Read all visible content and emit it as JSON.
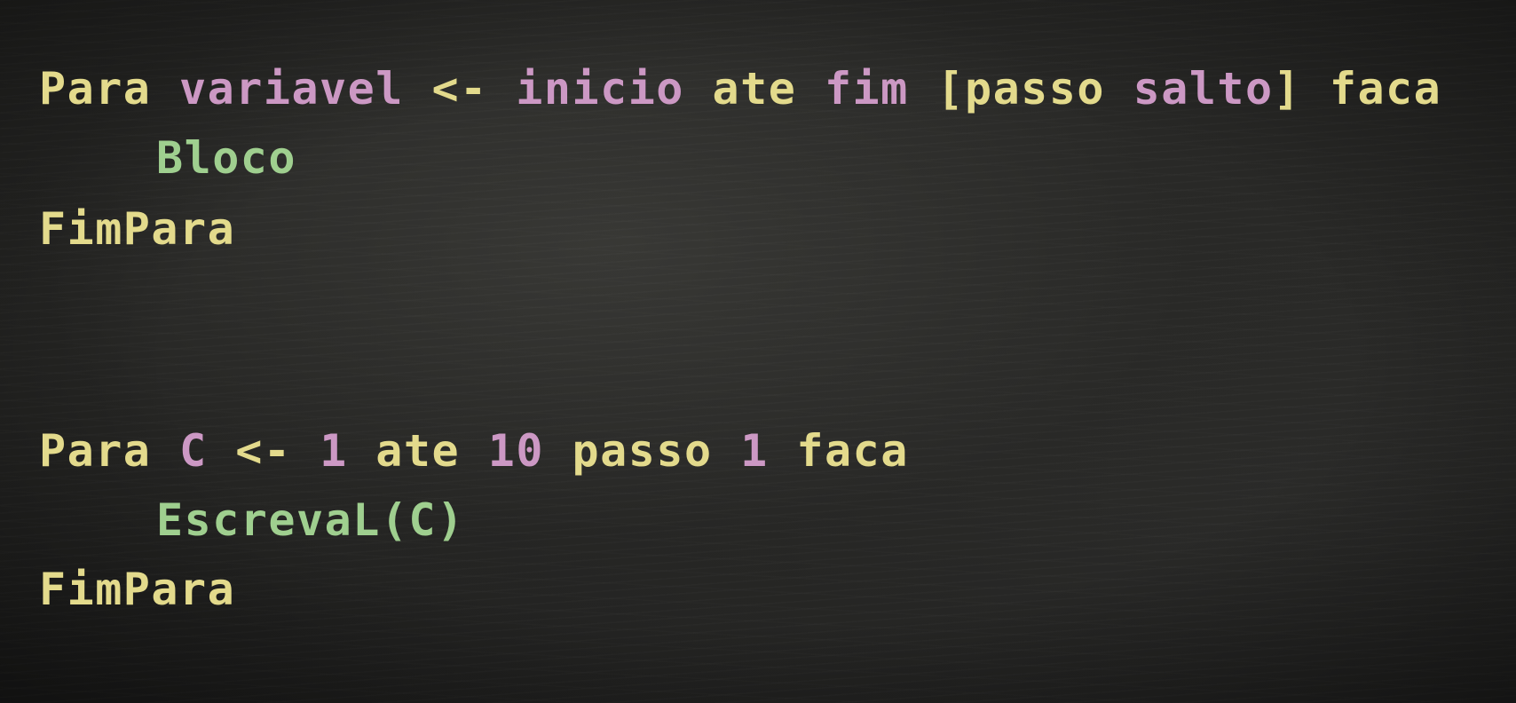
{
  "colors": {
    "keyword": "#e3da8c",
    "variable": "#cc98c4",
    "block": "#9fcf8f",
    "background": "#262624"
  },
  "syntax": {
    "line1": {
      "para": "Para",
      "variavel": "variavel",
      "arrow": "<-",
      "inicio": "inicio",
      "ate": "ate",
      "fim": "fim",
      "passo_open": "[passo",
      "salto": "salto",
      "passo_close": "]",
      "faca": "faca"
    },
    "line2": {
      "bloco": "Bloco"
    },
    "line3": {
      "fimpara": "FimPara"
    }
  },
  "example": {
    "line1": {
      "para": "Para",
      "var": "C",
      "arrow": "<-",
      "start": "1",
      "ate": "ate",
      "end": "10",
      "passo": "passo",
      "step": "1",
      "faca": "faca"
    },
    "line2": {
      "statement": "EscrevaL(C)"
    },
    "line3": {
      "fimpara": "FimPara"
    }
  }
}
